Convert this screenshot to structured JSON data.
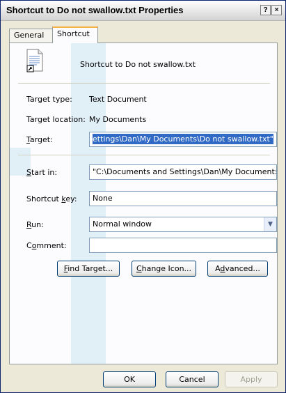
{
  "window": {
    "title": "Shortcut to Do not swallow.txt Properties",
    "help_button": "?",
    "close_button": "×"
  },
  "tabs": [
    {
      "label": "General",
      "active": false
    },
    {
      "label": "Shortcut",
      "active": true
    }
  ],
  "shortcut": {
    "name": "Shortcut to Do not swallow.txt",
    "target_type_label": "Target type:",
    "target_type_value": "Text Document",
    "target_location_label": "Target location:",
    "target_location_value": "My Documents",
    "target_label": "Target:",
    "target_value": "ettings\\Dan\\My Documents\\Do not swallow.txt\"",
    "start_in_label": "Start in:",
    "start_in_value": "\"C:\\Documents and Settings\\Dan\\My Document:",
    "shortcut_key_label": "Shortcut key:",
    "shortcut_key_value": "None",
    "run_label": "Run:",
    "run_value": "Normal window",
    "comment_label": "Comment:",
    "comment_value": ""
  },
  "buttons": {
    "find_target": "Find Target...",
    "change_icon": "Change Icon...",
    "advanced": "Advanced...",
    "ok": "OK",
    "cancel": "Cancel",
    "apply": "Apply"
  },
  "icons": {
    "file": "text-file-shortcut-icon",
    "dropdown": "chevron-down-icon"
  }
}
